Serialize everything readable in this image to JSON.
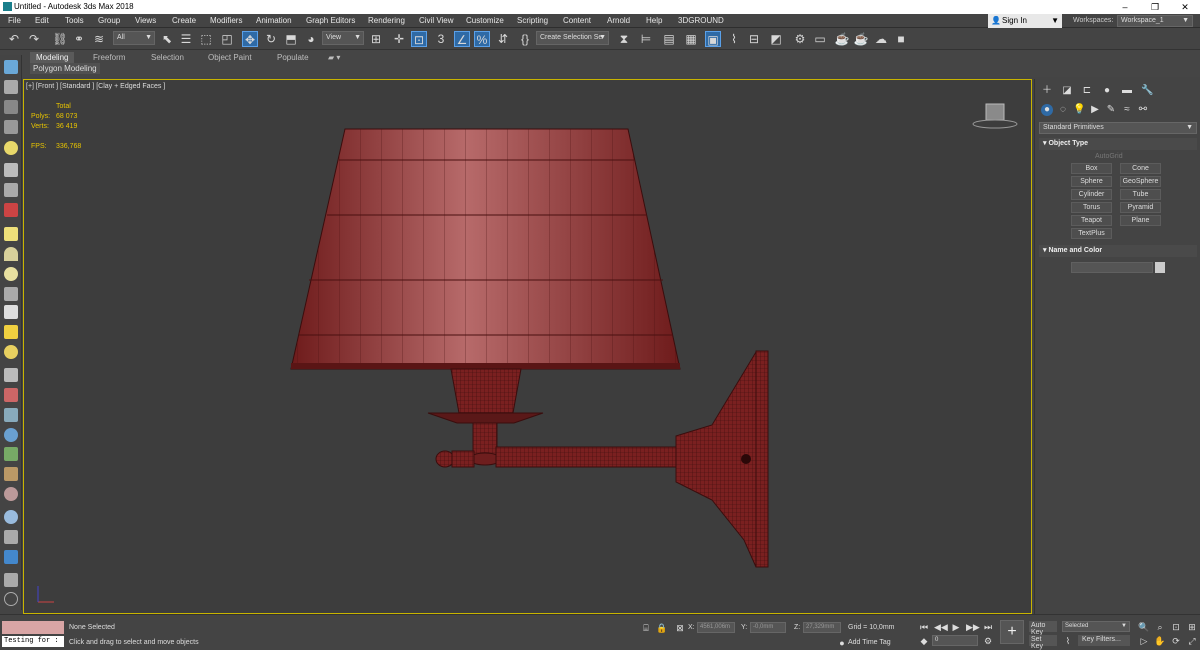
{
  "title": "Untitled - Autodesk 3ds Max 2018",
  "menus": [
    "File",
    "Edit",
    "Tools",
    "Group",
    "Views",
    "Create",
    "Modifiers",
    "Animation",
    "Graph Editors",
    "Rendering",
    "Civil View",
    "Customize",
    "Scripting",
    "Content",
    "Arnold",
    "Help",
    "3DGROUND"
  ],
  "signin": "Sign In",
  "workspaces_label": "Workspaces:",
  "workspace_value": "Workspace_1",
  "toolbar": {
    "selection_filter": "All",
    "ref_coord": "View",
    "named_selection": "Create Selection Se"
  },
  "ribbon": {
    "tabs": [
      "Modeling",
      "Freeform",
      "Selection",
      "Object Paint",
      "Populate"
    ],
    "sub": "Polygon Modeling"
  },
  "viewport": {
    "label": "[+] [Front ] [Standard ] [Clay + Edged Faces ]",
    "stats_total": "Total",
    "polys_label": "Polys:",
    "polys_value": "68 073",
    "verts_label": "Verts:",
    "verts_value": "36 419",
    "fps_label": "FPS:",
    "fps_value": "336,768"
  },
  "command_panel": {
    "category": "Standard Primitives",
    "object_type_title": "Object Type",
    "autogrid": "AutoGrid",
    "objects": [
      "Box",
      "Cone",
      "Sphere",
      "GeoSphere",
      "Cylinder",
      "Tube",
      "Torus",
      "Pyramid",
      "Teapot",
      "Plane",
      "TextPlus"
    ],
    "name_color_title": "Name and Color"
  },
  "status": {
    "maxscript": "Testing for :",
    "selection": "None Selected",
    "prompt": "Click and drag to select and move objects",
    "x_label": "X:",
    "x_value": "4561,006m",
    "y_label": "Y:",
    "y_value": "-0,0mm",
    "z_label": "Z:",
    "z_value": "27,329mm",
    "grid": "Grid = 10,0mm",
    "add_time_tag": "Add Time Tag",
    "auto_key": "Auto Key",
    "set_key": "Set Key",
    "selected": "Selected",
    "key_filters": "Key Filters...",
    "frame": "0"
  },
  "colors": {
    "accent": "#2f6aa5",
    "viewport_border": "#c8b400",
    "model": "#8b2a2a",
    "stats": "#e8c400"
  }
}
